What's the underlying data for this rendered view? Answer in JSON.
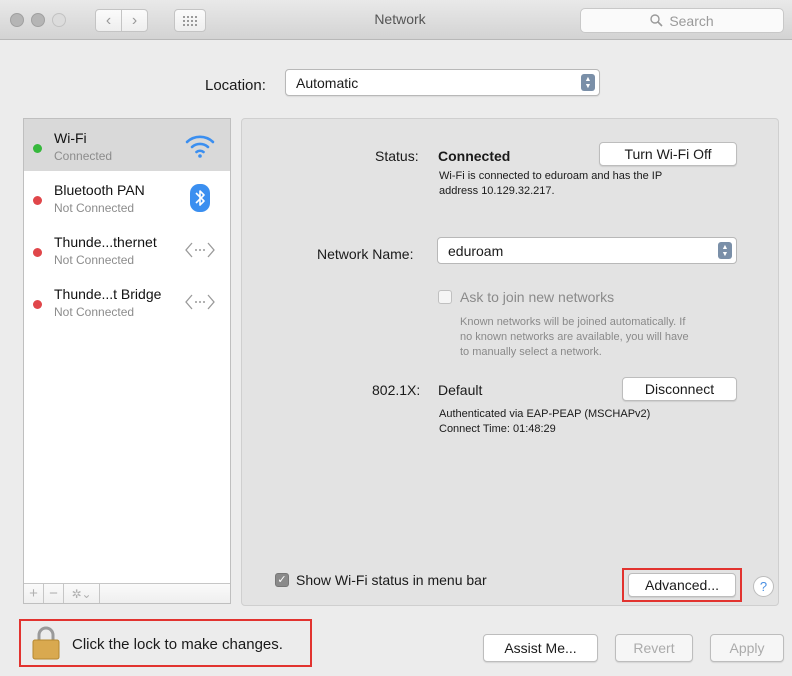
{
  "window": {
    "title": "Network"
  },
  "search": {
    "placeholder": "Search"
  },
  "location": {
    "label": "Location:",
    "value": "Automatic"
  },
  "sidebar": {
    "items": [
      {
        "name": "Wi-Fi",
        "status": "Connected",
        "status_color": "#36b83c",
        "icon": "wifi-icon",
        "selected": true
      },
      {
        "name": "Bluetooth PAN",
        "status": "Not Connected",
        "status_color": "#e0464a",
        "icon": "bluetooth-icon"
      },
      {
        "name": "Thunde...thernet",
        "status": "Not Connected",
        "status_color": "#e0464a",
        "icon": "ethernet-arrows-icon"
      },
      {
        "name": "Thunde...t Bridge",
        "status": "Not Connected",
        "status_color": "#e0464a",
        "icon": "ethernet-arrows-icon"
      }
    ],
    "footer": {
      "add": "+",
      "remove": "−",
      "gear": "✲⌄"
    }
  },
  "detail": {
    "status_label": "Status:",
    "status_value": "Connected",
    "turn_off_button": "Turn Wi-Fi Off",
    "status_desc_line1": "Wi-Fi is connected to eduroam and has the IP",
    "status_desc_line2": "address 10.129.32.217.",
    "network_name_label": "Network Name:",
    "network_name_value": "eduroam",
    "ask_join_label": "Ask to join new networks",
    "ask_join_desc_line1": "Known networks will be joined automatically. If",
    "ask_join_desc_line2": "no known networks are available, you will have",
    "ask_join_desc_line3": "to manually select a network.",
    "dot1x_label": "802.1X:",
    "dot1x_value": "Default",
    "disconnect_button": "Disconnect",
    "auth_line": "Authenticated via EAP-PEAP (MSCHAPv2)",
    "connect_time": "Connect Time: 01:48:29",
    "show_status_label": "Show Wi-Fi status in menu bar",
    "advanced_button": "Advanced...",
    "help": "?"
  },
  "bottom": {
    "lock_text": "Click the lock to make changes.",
    "assist_button": "Assist Me...",
    "revert_button": "Revert",
    "apply_button": "Apply"
  },
  "colors": {
    "highlight": "#e2332f",
    "selected_row": "#d9d9d9",
    "panel": "#e3e3e3"
  }
}
